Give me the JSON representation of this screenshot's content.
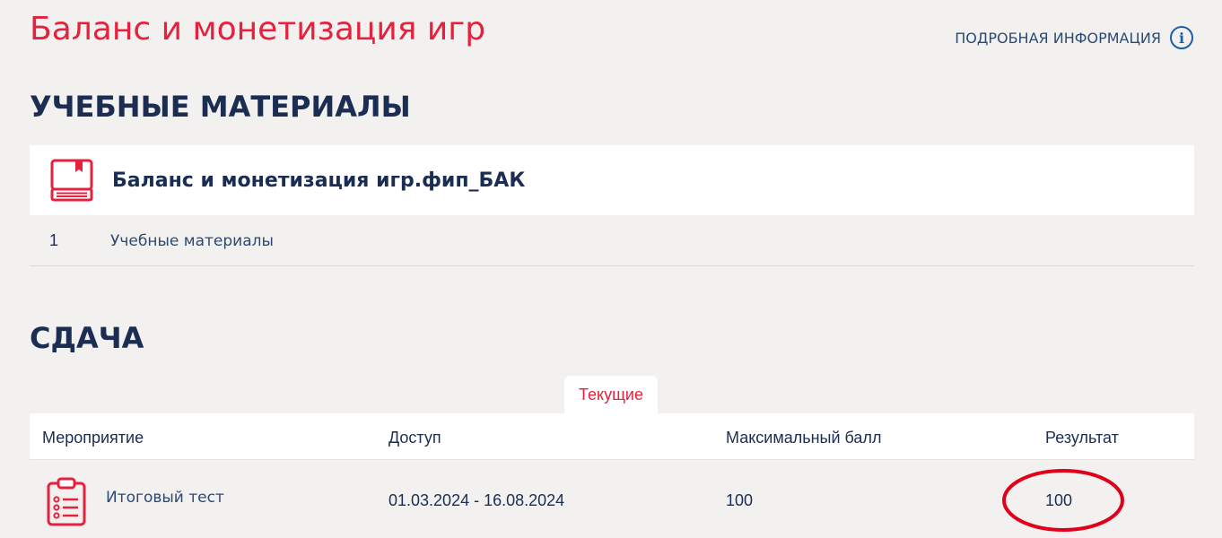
{
  "header": {
    "title": "Баланс и монетизация игр",
    "more_info_label": "ПОДРОБНАЯ ИНФОРМАЦИЯ",
    "info_icon": "info-circle-icon"
  },
  "materials": {
    "section_title": "УЧЕБНЫЕ МАТЕРИАЛЫ",
    "card_title": "Баланс и монетизация игр.фип_БАК",
    "card_icon": "book-icon",
    "rows": [
      {
        "num": "1",
        "label": "Учебные материалы"
      }
    ]
  },
  "submission": {
    "section_title": "СДАЧА",
    "tab_current": "Текущие",
    "columns": [
      "Мероприятие",
      "Доступ",
      "Максимальный балл",
      "Результат"
    ],
    "rows": [
      {
        "event": "Итоговый тест",
        "access": "01.03.2024 - 16.08.2024",
        "max_score": "100",
        "result": "100",
        "icon": "clipboard-list-icon"
      }
    ]
  },
  "colors": {
    "accent": "#e5213d",
    "title_dark": "#1b2d52",
    "link": "#2c4a74",
    "info_blue": "#1d5fa7",
    "background": "#f2f1ef",
    "annotation_circle": "#e0001b"
  }
}
